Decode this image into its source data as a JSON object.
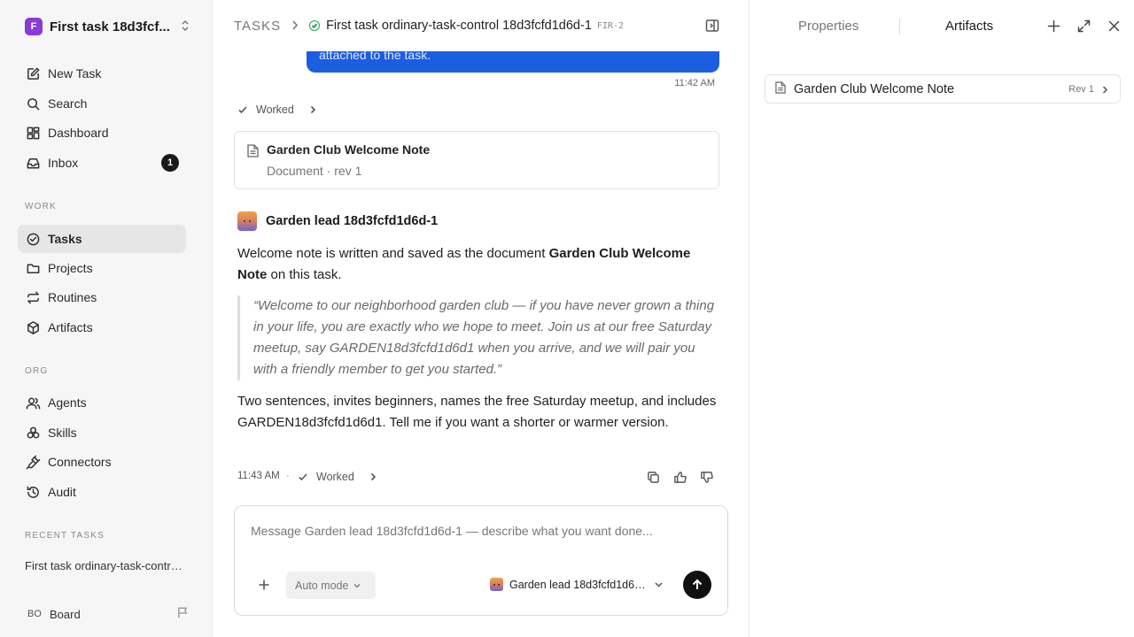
{
  "workspace": {
    "logo": "F",
    "name": "First task 18d3fcf..."
  },
  "sidebar": {
    "items": [
      {
        "label": "New Task",
        "icon": "edit-icon"
      },
      {
        "label": "Search",
        "icon": "search-icon"
      },
      {
        "label": "Dashboard",
        "icon": "dashboard-icon"
      },
      {
        "label": "Inbox",
        "icon": "inbox-icon",
        "badge": "1"
      }
    ],
    "work_label": "WORK",
    "work_items": [
      {
        "label": "Tasks",
        "icon": "tasks-icon",
        "active": true
      },
      {
        "label": "Projects",
        "icon": "folder-icon"
      },
      {
        "label": "Routines",
        "icon": "routines-icon"
      },
      {
        "label": "Artifacts",
        "icon": "cube-icon"
      }
    ],
    "org_label": "ORG",
    "org_items": [
      {
        "label": "Agents",
        "icon": "users-icon"
      },
      {
        "label": "Skills",
        "icon": "skills-icon"
      },
      {
        "label": "Connectors",
        "icon": "plug-icon"
      },
      {
        "label": "Audit",
        "icon": "history-icon"
      }
    ],
    "recent_label": "RECENT TASKS",
    "recent_item": "First task ordinary-task-control 18d3fcfd1d6d-1",
    "board": {
      "initials": "BO",
      "name": "Board"
    }
  },
  "header": {
    "root": "TASKS",
    "title": "First task ordinary-task-control 18d3fcfd1d6d-1",
    "id": "FIR-2"
  },
  "thread": {
    "user_bubble_tail": "attached to the task.",
    "user_time": "11:42 AM",
    "worked_label": "Worked",
    "doc_card": {
      "title": "Garden Club Welcome Note",
      "meta": "Document · rev 1"
    },
    "agent_name": "Garden lead 18d3fcfd1d6d-1",
    "msg_intro": "Welcome note is written and saved as the document ",
    "msg_doc_name": "Garden Club Welcome Note",
    "msg_intro_end": " on this task.",
    "quote": "“Welcome to our neighborhood garden club — if you have never grown a thing in your life, you are exactly who we hope to meet. Join us at our free Saturday meetup, say GARDEN18d3fcfd1d6d1 when you arrive, and we will pair you with a friendly member to get you started.”",
    "msg_followup": "Two sentences, invites beginners, names the free Saturday meetup, and includes GARDEN18d3fcfd1d6d1. Tell me if you want a shorter or warmer version.",
    "agent_time": "11:43 AM",
    "dot": "·"
  },
  "composer": {
    "placeholder": "Message Garden lead 18d3fcfd1d6d-1 — describe what you want done...",
    "mode": "Auto mode",
    "agent": "Garden lead 18d3fcfd1d6d-1"
  },
  "right_panel": {
    "tab_properties": "Properties",
    "tab_artifacts": "Artifacts",
    "artifact": {
      "name": "Garden Club Welcome Note",
      "rev": "Rev 1"
    }
  },
  "colors": {
    "accent": "#1b5fe0",
    "logo": "#8a3ad6",
    "status": "#2e9e5b"
  }
}
